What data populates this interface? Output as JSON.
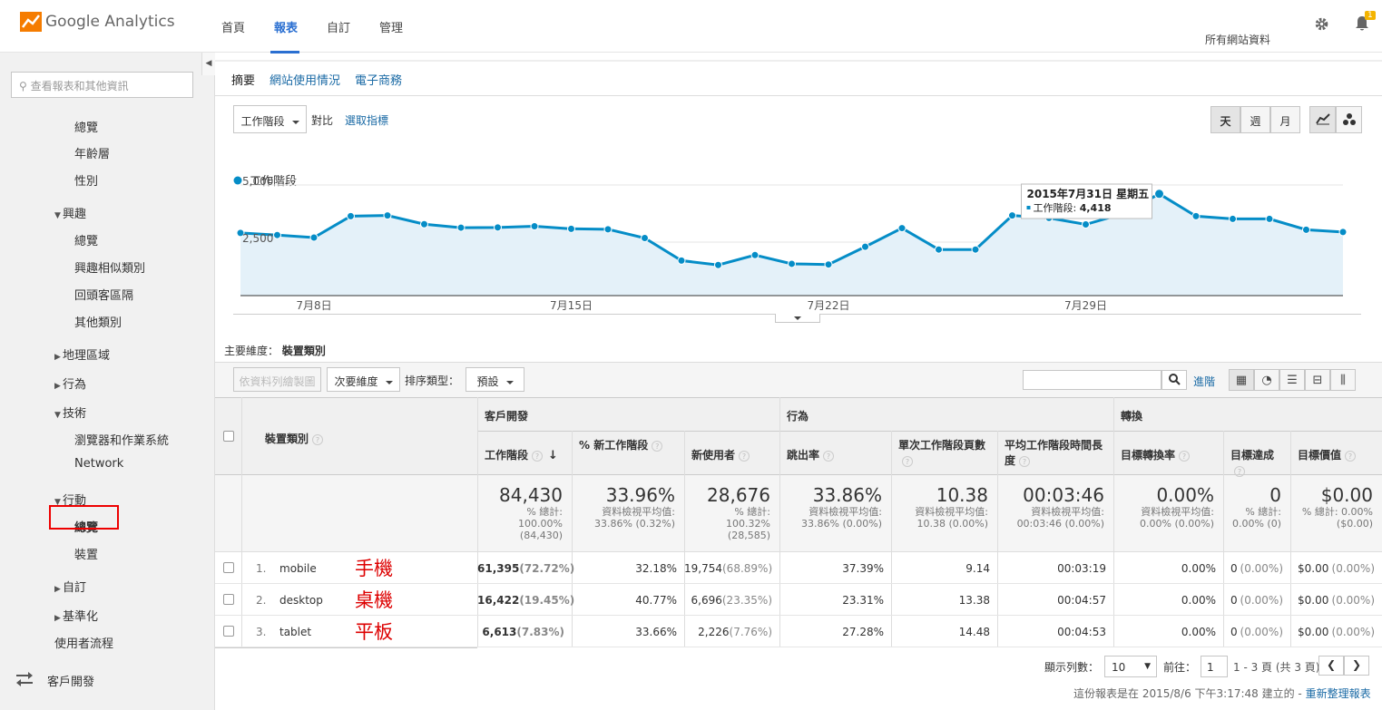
{
  "header": {
    "logo_text": "Google Analytics",
    "nav": [
      "首頁",
      "報表",
      "自訂",
      "管理"
    ],
    "account": "所有網站資料",
    "bell_badge": "1"
  },
  "sidebar": {
    "search_placeholder": "查看報表和其他資訊",
    "collapse": "◀",
    "items": [
      {
        "label": "總覽",
        "indent": 2
      },
      {
        "label": "年齡層",
        "indent": 2
      },
      {
        "label": "性別",
        "indent": 2
      },
      {
        "label": "興趣",
        "indent": 1,
        "open": true
      },
      {
        "label": "總覽",
        "indent": 2
      },
      {
        "label": "興趣相似類別",
        "indent": 2
      },
      {
        "label": "回頭客區隔",
        "indent": 2
      },
      {
        "label": "其他類別",
        "indent": 2
      },
      {
        "label": "地理區域",
        "indent": 1,
        "open": false
      },
      {
        "label": "行為",
        "indent": 1,
        "open": false
      },
      {
        "label": "技術",
        "indent": 1,
        "open": true
      },
      {
        "label": "瀏覽器和作業系統",
        "indent": 2
      },
      {
        "label": "Network",
        "indent": 2
      },
      {
        "label": "行動",
        "indent": 1,
        "open": true
      },
      {
        "label": "總覽",
        "indent": 2,
        "bold": true
      },
      {
        "label": "裝置",
        "indent": 2
      },
      {
        "label": "自訂",
        "indent": 1,
        "open": false
      },
      {
        "label": "基準化",
        "indent": 1,
        "open": false
      },
      {
        "label": "使用者流程",
        "indent": 0
      }
    ],
    "bottom": "客戶開發"
  },
  "tabs": [
    "摘要",
    "網站使用情況",
    "電子商務"
  ],
  "controls": {
    "metric": "工作階段",
    "vs": "對比",
    "pick": "選取指標",
    "day": "天",
    "week": "週",
    "month": "月"
  },
  "chart_data": {
    "type": "area",
    "legend": "工作階段",
    "ylim": [
      0,
      5000
    ],
    "yticks": [
      "5,000",
      "2,500"
    ],
    "xticks": [
      {
        "label": "7月8日",
        "i": 2
      },
      {
        "label": "7月15日",
        "i": 9
      },
      {
        "label": "7月22日",
        "i": 16
      },
      {
        "label": "7月29日",
        "i": 23
      }
    ],
    "values": [
      2720,
      2630,
      2520,
      3450,
      3480,
      3100,
      2950,
      2960,
      3010,
      2900,
      2880,
      2500,
      1520,
      1330,
      1760,
      1380,
      1350,
      2120,
      2930,
      2000,
      2000,
      3480,
      3370,
      3090,
      3550,
      4418,
      3450,
      3330,
      3330,
      2860,
      2760
    ],
    "tooltip": {
      "date": "2015年7月31日 星期五",
      "label": "工作階段",
      "value": "4,418",
      "i": 25
    }
  },
  "dimension": {
    "label": "主要維度：",
    "value": "裝置類別"
  },
  "toolbar": {
    "plot": "依資料列繪製圖表",
    "secondary": "次要維度",
    "sort_label": "排序類型：",
    "sort": "預設",
    "advanced": "進階"
  },
  "table": {
    "groups": [
      "客戶開發",
      "行為",
      "轉換"
    ],
    "dim_header": "裝置類別",
    "cols": [
      "工作階段",
      "% 新工作階段",
      "新使用者",
      "跳出率",
      "單次工作階段頁數",
      "平均工作階段時間長度",
      "目標轉換率",
      "目標達成",
      "目標價值"
    ],
    "totals": [
      {
        "v": "84,430",
        "s": "% 總計:\n100.00%\n(84,430)"
      },
      {
        "v": "33.96%",
        "s": "資料檢視平均值:\n33.86% (0.32%)"
      },
      {
        "v": "28,676",
        "s": "% 總計:\n100.32%\n(28,585)"
      },
      {
        "v": "33.86%",
        "s": "資料檢視平均值:\n33.86% (0.00%)"
      },
      {
        "v": "10.38",
        "s": "資料檢視平均值:\n10.38 (0.00%)"
      },
      {
        "v": "00:03:46",
        "s": "資料檢視平均值:\n00:03:46 (0.00%)"
      },
      {
        "v": "0.00%",
        "s": "資料檢視平均值:\n0.00% (0.00%)"
      },
      {
        "v": "0",
        "s": "% 總計:\n0.00% (0)"
      },
      {
        "v": "$0.00",
        "s": "% 總計: 0.00%\n($0.00)"
      }
    ],
    "rows": [
      {
        "n": "1.",
        "dev": "mobile",
        "note": "手機",
        "s": "61,395",
        "sp": "(72.72%)",
        "pn": "32.18%",
        "nu": "19,754",
        "nup": "(68.89%)",
        "b": "37.39%",
        "pp": "9.14",
        "t": "00:03:19",
        "cr": "0.00%",
        "g": "0",
        "gp": "(0.00%)",
        "gv": "$0.00",
        "gvp": "(0.00%)"
      },
      {
        "n": "2.",
        "dev": "desktop",
        "note": "桌機",
        "s": "16,422",
        "sp": "(19.45%)",
        "pn": "40.77%",
        "nu": "6,696",
        "nup": "(23.35%)",
        "b": "23.31%",
        "pp": "13.38",
        "t": "00:04:57",
        "cr": "0.00%",
        "g": "0",
        "gp": "(0.00%)",
        "gv": "$0.00",
        "gvp": "(0.00%)"
      },
      {
        "n": "3.",
        "dev": "tablet",
        "note": "平板",
        "s": "6,613",
        "sp": "(7.83%)",
        "pn": "33.66%",
        "nu": "2,226",
        "nup": "(7.76%)",
        "b": "27.28%",
        "pp": "14.48",
        "t": "00:04:53",
        "cr": "0.00%",
        "g": "0",
        "gp": "(0.00%)",
        "gv": "$0.00",
        "gvp": "(0.00%)"
      }
    ]
  },
  "footer": {
    "rows_label": "顯示列數：",
    "rows": "10",
    "goto": "前往：",
    "page": "1",
    "range": "1 - 3 頁 (共 3 頁)",
    "note": "這份報表是在 2015/8/6 下午3:17:48 建立的 - ",
    "refresh": "重新整理報表"
  },
  "colors": {
    "accent": "#058dc7",
    "area": "#e4f1f9",
    "link": "#1a6aa5"
  }
}
